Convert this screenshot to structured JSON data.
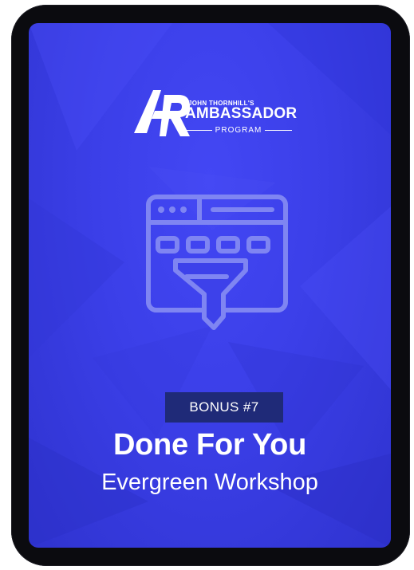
{
  "logo": {
    "top_line": "JOHN THORNHILL'S",
    "main": "AMBASSADOR",
    "sub": "PROGRAM",
    "mark_icon": "ap-monogram-icon"
  },
  "illustration": {
    "icon": "browser-funnel-icon"
  },
  "badge": {
    "label": "BONUS #7"
  },
  "heading": {
    "title": "Done For You",
    "subtitle": "Evergreen Workshop"
  },
  "colors": {
    "background": "#3b3fe8",
    "badge_bg": "#1f2a78",
    "icon_stroke": "#7f85f2",
    "text": "#ffffff",
    "frame": "#0b0b0f"
  }
}
